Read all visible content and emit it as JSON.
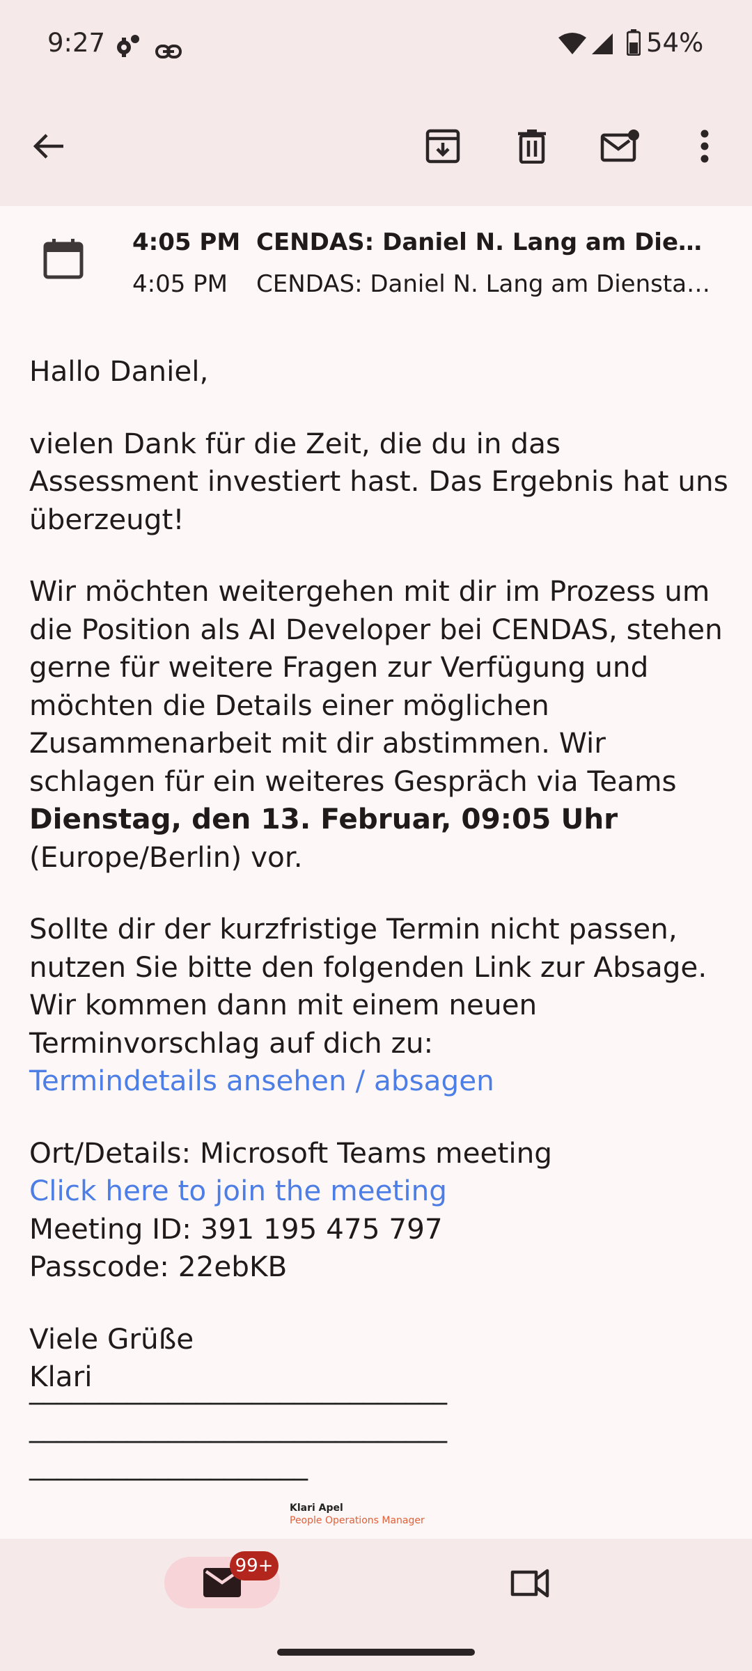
{
  "status_bar": {
    "time": "9:27",
    "battery_percent": "54%",
    "icons": [
      "settings-alert-icon",
      "link-icon",
      "wifi-icon",
      "cell-signal-icon",
      "battery-icon"
    ]
  },
  "app_bar": {
    "icons": [
      "back-arrow-icon",
      "archive-icon",
      "delete-icon",
      "mark-unread-icon",
      "more-vert-icon"
    ]
  },
  "calendar_event": {
    "icon": "calendar-icon",
    "line1_time": "4:05 PM",
    "line1_title": "CENDAS: Daniel N. Lang am Dienst…",
    "line2_time": "4:05 PM",
    "line2_title": "CENDAS: Daniel N. Lang am Dienstag,…"
  },
  "email": {
    "greeting": "Hallo Daniel,",
    "para1": "vielen Dank für die Zeit, die du in das Assessment investiert hast. Das Ergebnis hat uns überzeugt!",
    "para2_start": "Wir möchten weitergehen mit dir im Prozess um die Position als AI Developer bei CENDAS, stehen gerne für weitere Fragen zur Verfügung und möchten die Details einer möglichen Zusammenarbeit mit dir abstimmen. Wir schlagen für ein weiteres Gespräch via Teams ",
    "para2_bold": "Dienstag, den 13. Februar, 09:05 Uhr",
    "para2_end": " (Europe/Berlin) vor.",
    "para3": "Sollte dir der kurzfristige Termin nicht passen, nutzen Sie bitte den folgenden Link zur Absage. Wir kommen dann mit einem neuen Terminvorschlag auf dich zu:",
    "termin_link": "Termindetails ansehen / absagen",
    "location": "Ort/Details: Microsoft Teams meeting",
    "join_link": "Click here to join the meeting",
    "meeting_id": "Meeting ID: 391 195 475 797",
    "passcode": "Passcode: 22ebKB",
    "closing": "Viele Grüße",
    "sender_first": "Klari",
    "sig_line1": "______________________________",
    "sig_line2": "______________________________",
    "sig_line3": "____________________",
    "sig_name": "Klari Apel",
    "sig_role": "People Operations Manager"
  },
  "bottom_nav": {
    "mail_badge": "99+",
    "icons": [
      "mail-icon",
      "video-icon"
    ]
  },
  "colors": {
    "bar_bg": "#f5e9ea",
    "page_bg": "#fdf7f7",
    "link": "#4d7ee6",
    "badge": "#b3261e",
    "pill": "#f6d4d7",
    "role_accent": "#e0603a"
  }
}
